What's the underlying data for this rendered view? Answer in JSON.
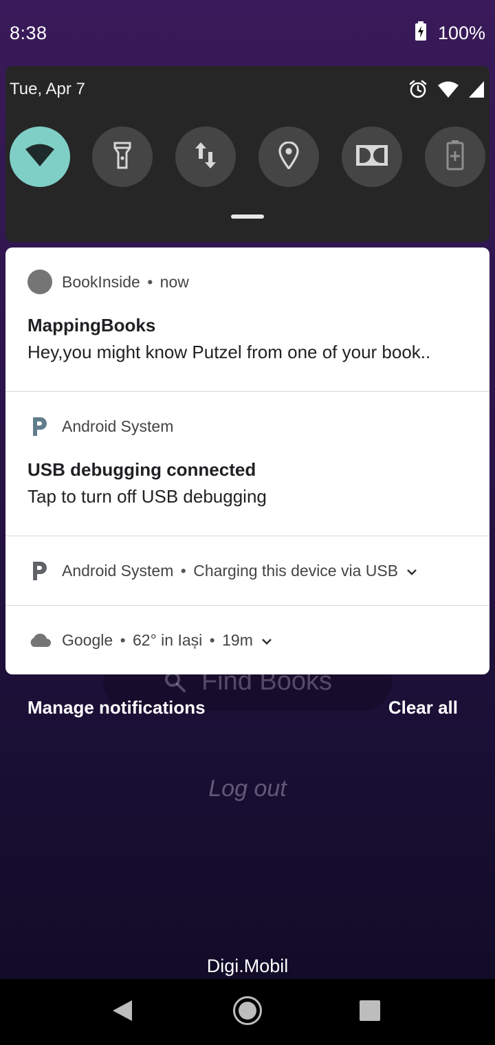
{
  "status_bar": {
    "time": "8:38",
    "battery_percent": "100%",
    "battery_icon": "battery-charging-icon"
  },
  "quick_settings": {
    "date": "Tue, Apr 7",
    "status_icons": [
      "alarm-icon",
      "wifi-icon",
      "cell-signal-icon"
    ],
    "tiles": [
      {
        "name": "wifi",
        "icon": "wifi-icon",
        "active": true
      },
      {
        "name": "flashlight",
        "icon": "flashlight-icon",
        "active": false
      },
      {
        "name": "mobile-data",
        "icon": "data-arrows-icon",
        "active": false
      },
      {
        "name": "location",
        "icon": "location-pin-icon",
        "active": false
      },
      {
        "name": "dolby",
        "icon": "dolby-icon",
        "active": false
      },
      {
        "name": "battery-saver",
        "icon": "battery-saver-icon",
        "active": false
      }
    ],
    "active_color": "#7fcfc6",
    "inactive_color": "#454545"
  },
  "notifications": [
    {
      "app": "BookInside",
      "time": "now",
      "title": "MappingBooks",
      "text": "Hey,you might know Putzel from one of your book.."
    },
    {
      "app": "Android System",
      "title": "USB debugging connected",
      "text": "Tap to turn off USB debugging"
    },
    {
      "app": "Android System",
      "summary": "Charging this device via USB"
    },
    {
      "app": "Google",
      "summary": "62° in Iași",
      "time": "19m"
    }
  ],
  "footer": {
    "manage_label": "Manage notifications",
    "clear_label": "Clear all"
  },
  "background_app": {
    "search_placeholder": "Find Books",
    "logout_label": "Log out",
    "carrier": "Digi.Mobil"
  },
  "nav_bar": {
    "buttons": [
      "back-icon",
      "home-icon",
      "recents-icon"
    ]
  }
}
